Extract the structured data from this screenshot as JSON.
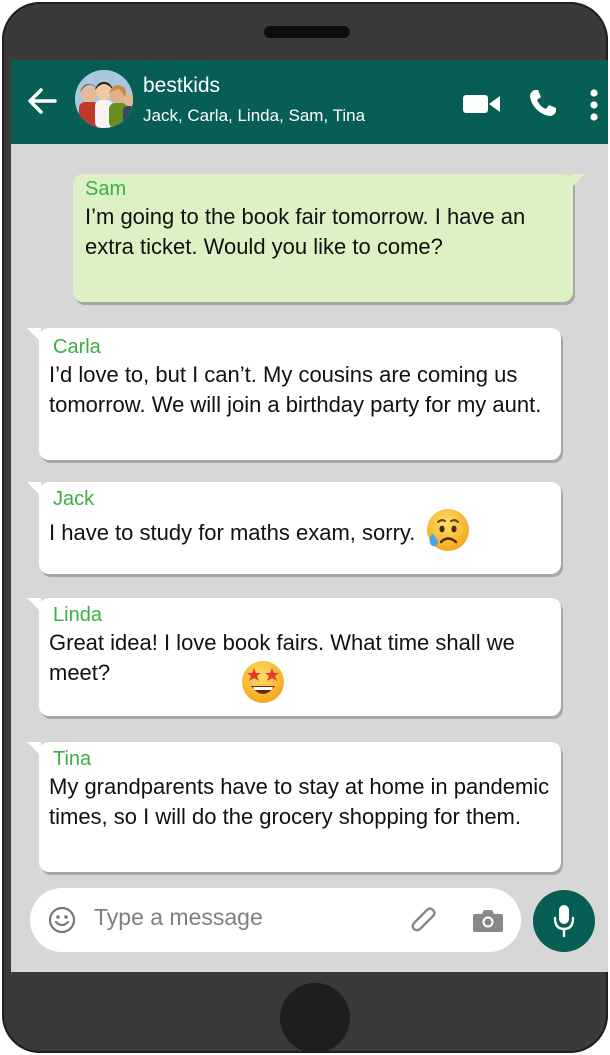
{
  "header": {
    "title": "bestkids",
    "subtitle": "Jack, Carla, Linda, Sam, Tina",
    "icons": [
      "back-arrow-icon",
      "group-avatar",
      "video-call-icon",
      "phone-icon",
      "more-options-icon"
    ]
  },
  "messages": [
    {
      "sender": "Sam",
      "text": "I’m going to the book fair tomorrow. I have an extra ticket. Would you like to come?",
      "direction": "outgoing"
    },
    {
      "sender": "Carla",
      "text": "I’d love to, but I can’t. My cousins are coming us tomorrow. We will join a birthday party for my aunt.",
      "direction": "incoming"
    },
    {
      "sender": "Jack",
      "text": "I have to study for maths exam, sorry.",
      "direction": "incoming",
      "emoji": "sad-tear-emoji"
    },
    {
      "sender": "Linda",
      "text": "Great idea! I love book fairs. What time shall we meet?",
      "direction": "incoming",
      "emoji": "star-struck-emoji"
    },
    {
      "sender": "Tina",
      "text": "My grandparents have to stay at home in pandemic times, so I will do the grocery shopping for them.",
      "direction": "incoming"
    }
  ],
  "input": {
    "placeholder": "Type a message",
    "icons": [
      "smiley-icon",
      "attach-icon",
      "camera-icon",
      "mic-icon"
    ]
  },
  "colors": {
    "header": "#075e54",
    "sender_name": "#3cae48",
    "outgoing_bubble": "#dcf2c4",
    "incoming_bubble": "#ffffff",
    "chat_background": "#d7d7d7",
    "phone_frame": "#3a3a3a"
  }
}
